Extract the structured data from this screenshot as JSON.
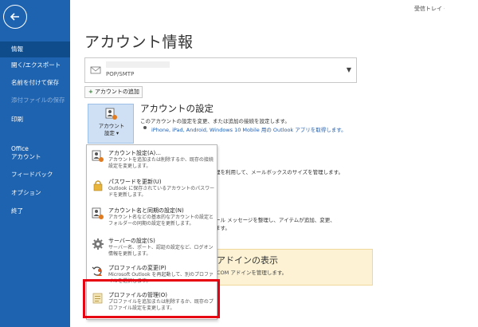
{
  "sidebar": {
    "items": [
      {
        "label": "情報"
      },
      {
        "label": "開く/エクスポート"
      },
      {
        "label": "名前を付けて保存"
      },
      {
        "label": "添付ファイルの保存"
      },
      {
        "label": "印刷"
      },
      {
        "label": "Office"
      },
      {
        "label": "アカウント"
      },
      {
        "label": "フィードバック"
      },
      {
        "label": "オプション"
      },
      {
        "label": "終了"
      }
    ]
  },
  "header": {
    "inbox_label": "受信トレイ -",
    "page_title": "アカウント情報"
  },
  "account": {
    "type": "POP/SMTP",
    "add_button": "アカウントの追加"
  },
  "settings": {
    "button_label_1": "アカウント",
    "button_label_2": "設定 ▾",
    "heading": "アカウントの設定",
    "desc": "このアカウントの設定を変更、または追加の接続を設定します。",
    "link": "iPhone, iPad, Android, Windows 10 Mobile 用の Outlook アプリを取得します。"
  },
  "background": {
    "line1": "理を利用して、メールボックスのサイズを管理します。",
    "line2": "ール メッセージを整理し、アイテムが追加、変更、",
    "line3": "ます。",
    "addin_title": "アドインの表示",
    "addin_desc": "COM アドインを管理します。"
  },
  "menu": {
    "items": [
      {
        "title": "アカウント設定(A)...",
        "desc": "アカウントを追加または削除するか、既存の接続設定を変更します。",
        "icon": "account-settings-icon"
      },
      {
        "title": "パスワードを更新(U)",
        "desc": "Outlook に保存されているアカウントのパスワードを更新します。",
        "icon": "lock-icon"
      },
      {
        "title": "アカウント名と同期の設定(N)",
        "desc": "アカウント名などの基本的なアカウントの設定とフォルダーの同期の設定を更新します。",
        "icon": "account-sync-icon"
      },
      {
        "title": "サーバーの設定(S)",
        "desc": "サーバー名、ポート、認証の設定など、ログオン情報を更新します。",
        "icon": "gear-icon"
      },
      {
        "title": "プロファイルの変更(P)",
        "desc": "Microsoft Outlook を再起動して、別のプロファイルを選択します。",
        "icon": "profile-change-icon"
      },
      {
        "title": "プロファイルの管理(O)",
        "desc": "プロファイルを追加または削除するか、既存のプロファイル設定を変更します。",
        "icon": "profile-manage-icon"
      }
    ]
  },
  "colors": {
    "sidebar": "#1e63b0",
    "highlight": "#e60012",
    "link": "#1e5fb4"
  }
}
